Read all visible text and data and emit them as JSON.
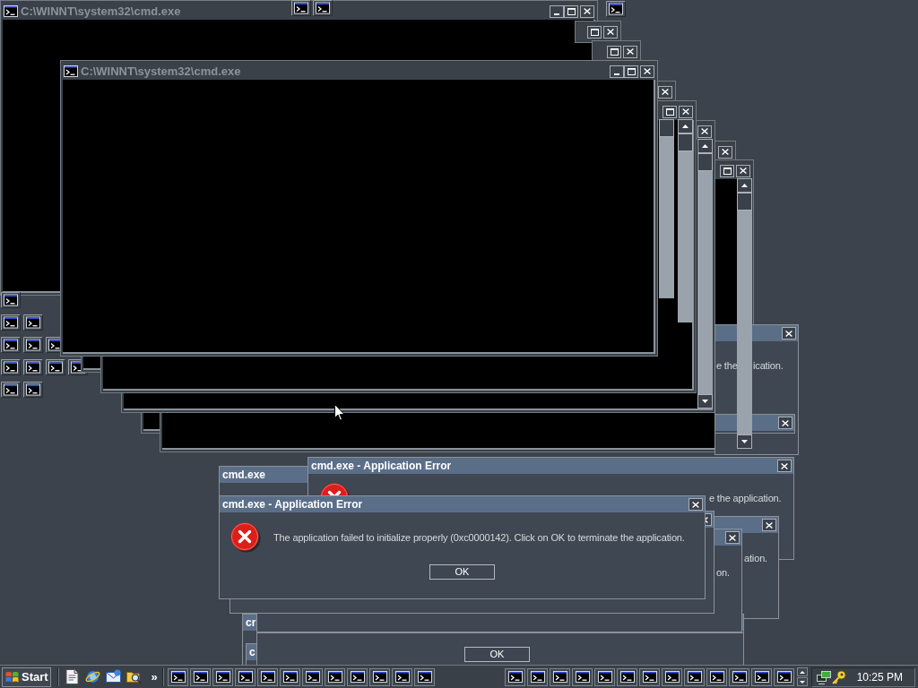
{
  "desktop": {
    "console_windows": [
      {
        "title": "C:\\WINNT\\system32\\cmd.exe"
      },
      {
        "title": "C:\\WINNT\\system32\\cmd.exe"
      }
    ],
    "dialogs": [
      {
        "message_parts": [
          "e the",
          "ication."
        ]
      },
      {
        "title": "cmd.exe"
      },
      {
        "title": "cmd.exe - Application Error",
        "message_parts": [
          "e the application."
        ]
      },
      {
        "message_parts": [
          "ation."
        ]
      },
      {
        "title": "cr"
      },
      {
        "message_parts": [
          "on."
        ]
      },
      {
        "title": "c"
      },
      {
        "button": "OK"
      },
      {
        "title": "cmd.exe - Application Error",
        "message": "The application failed to initialize properly (0xc0000142). Click on OK to terminate the application.",
        "button": "OK"
      }
    ]
  },
  "taskbar": {
    "start": "Start",
    "more": "»",
    "clock": "10:25 PM"
  }
}
